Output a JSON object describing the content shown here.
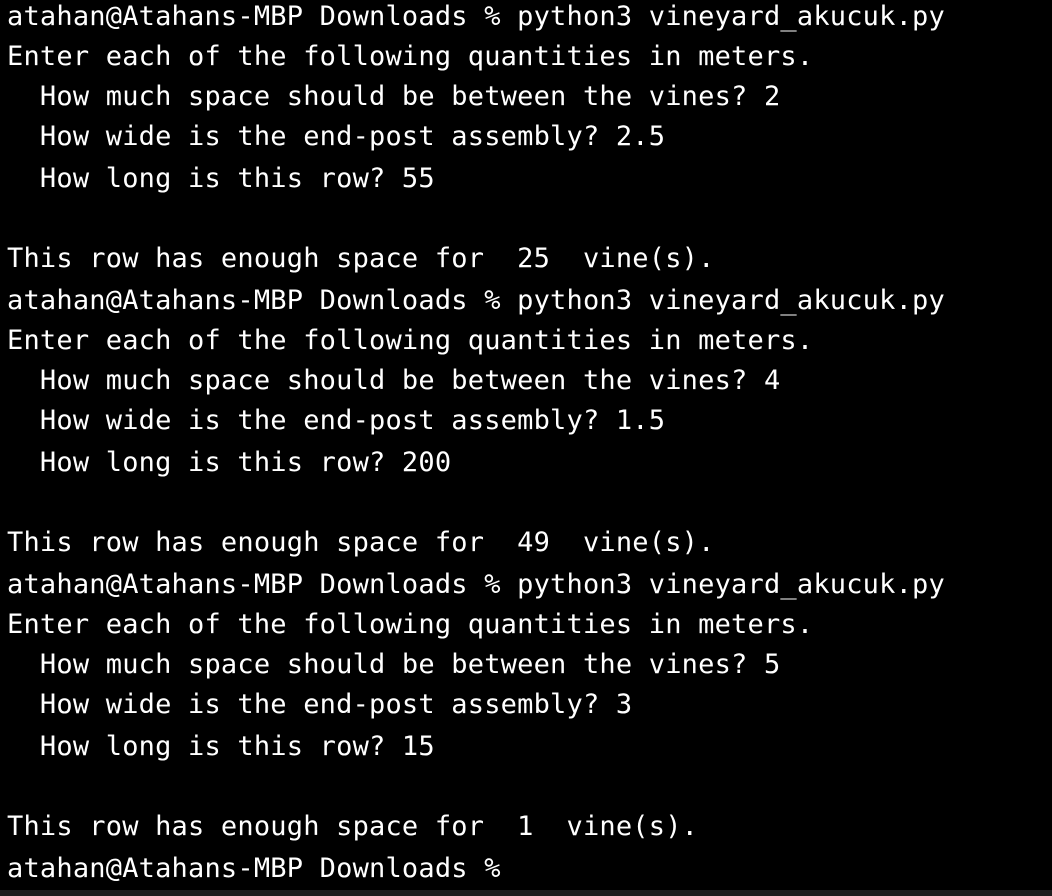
{
  "terminal": {
    "lines": [
      "atahan@Atahans-MBP Downloads % python3 vineyard_akucuk.py",
      "Enter each of the following quantities in meters.",
      "  How much space should be between the vines? 2",
      "  How wide is the end-post assembly? 2.5",
      "  How long is this row? 55",
      "",
      "This row has enough space for  25  vine(s).",
      "atahan@Atahans-MBP Downloads % python3 vineyard_akucuk.py",
      "Enter each of the following quantities in meters.",
      "  How much space should be between the vines? 4",
      "  How wide is the end-post assembly? 1.5",
      "  How long is this row? 200",
      "",
      "This row has enough space for  49  vine(s).",
      "atahan@Atahans-MBP Downloads % python3 vineyard_akucuk.py",
      "Enter each of the following quantities in meters.",
      "  How much space should be between the vines? 5",
      "  How wide is the end-post assembly? 3",
      "  How long is this row? 15",
      "",
      "This row has enough space for  1  vine(s).",
      "atahan@Atahans-MBP Downloads % "
    ]
  }
}
